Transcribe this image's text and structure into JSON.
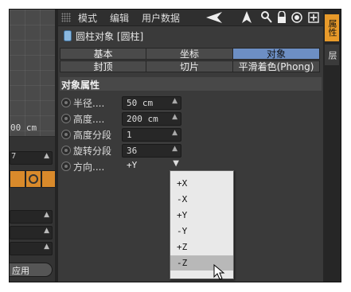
{
  "viewport": {
    "unit_text": "00 cm"
  },
  "left_panel": {
    "number_text": "7",
    "button_label": "应用"
  },
  "menubar": {
    "items": [
      "模式",
      "编辑",
      "用户数据"
    ],
    "tool_icons": [
      "back-arrow-icon",
      "up-arrow-icon",
      "search-icon",
      "lock-icon",
      "target-icon",
      "add-icon"
    ]
  },
  "object": {
    "title": "圆柱对象 [圆柱]"
  },
  "tabs": {
    "row1": [
      "基本",
      "坐标",
      "对象"
    ],
    "row2": [
      "封顶",
      "切片",
      "平滑着色(Phong)"
    ],
    "active": "对象"
  },
  "section": {
    "title": "对象属性"
  },
  "properties": [
    {
      "label": "半径....",
      "value": "50 cm"
    },
    {
      "label": "高度....",
      "value": "200 cm"
    },
    {
      "label": "高度分段",
      "value": "1"
    },
    {
      "label": "旋转分段",
      "value": "36"
    },
    {
      "label": "方向....",
      "value": "+Y"
    }
  ],
  "direction_options": [
    "+X",
    "-X",
    "+Y",
    "-Y",
    "+Z",
    "-Z"
  ],
  "highlighted_option": "-Z",
  "side_tabs": [
    "属性",
    "层"
  ],
  "colors": {
    "active_tab": "#6d8fc4",
    "side_tab_active": "#e89a2a",
    "panel_bg": "#3a3a3a"
  }
}
